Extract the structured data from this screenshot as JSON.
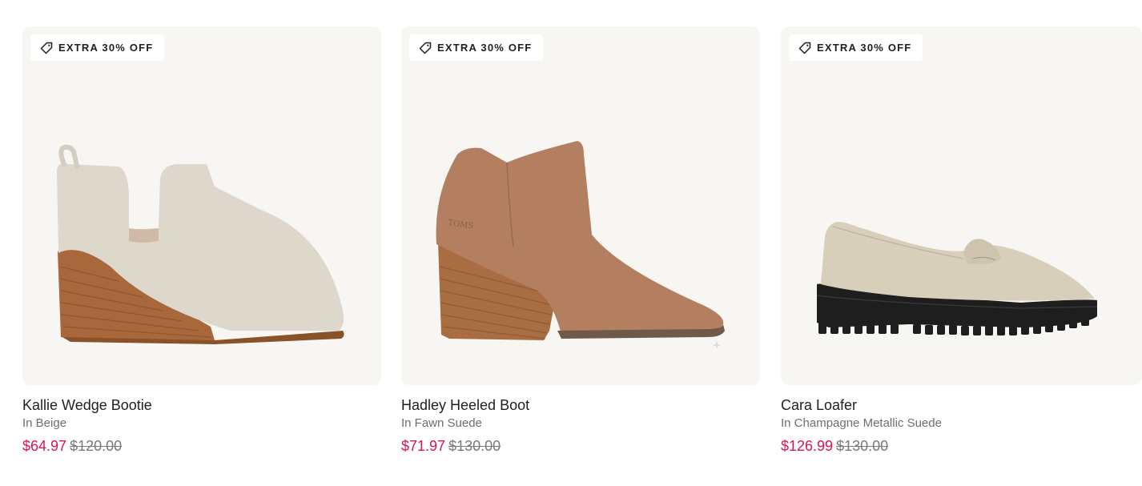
{
  "products": [
    {
      "badge": "EXTRA 30% OFF",
      "name": "Kallie Wedge Bootie",
      "color": "In Beige",
      "sale_price": "$64.97",
      "original_price": "$120.00"
    },
    {
      "badge": "EXTRA 30% OFF",
      "name": "Hadley Heeled Boot",
      "color": "In Fawn Suede",
      "sale_price": "$71.97",
      "original_price": "$130.00",
      "image_text": "TOMS"
    },
    {
      "badge": "EXTRA 30% OFF",
      "name": "Cara Loafer",
      "color": "In Champagne Metallic Suede",
      "sale_price": "$126.99",
      "original_price": "$130.00"
    }
  ],
  "colors": {
    "sale": "#d6135c",
    "card_bg": "#f7f6f3"
  },
  "icons": {
    "badge": "price-tag-icon"
  }
}
